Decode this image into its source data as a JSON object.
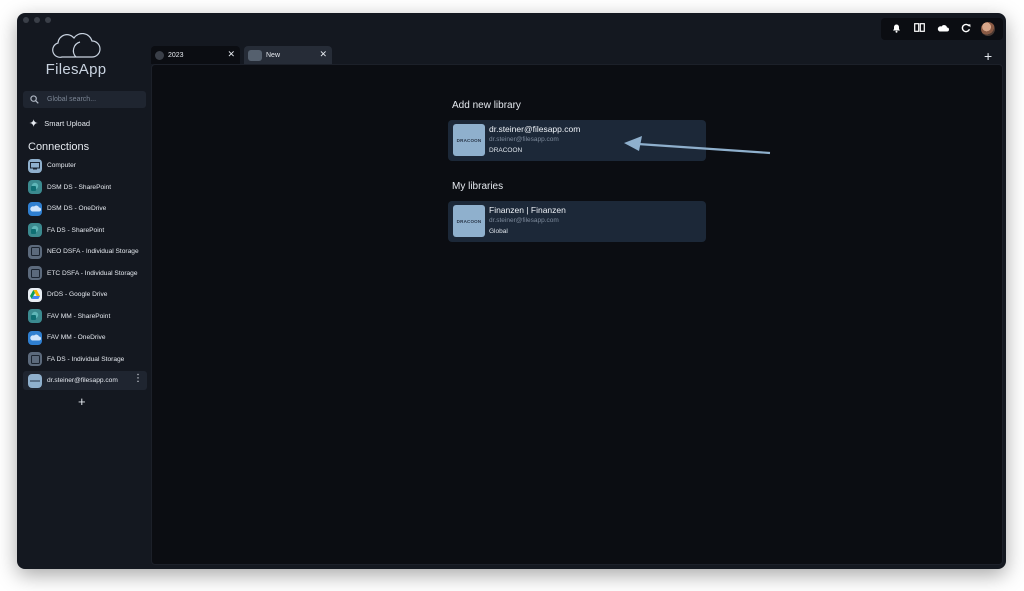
{
  "app": {
    "name": "FilesApp"
  },
  "sidebar": {
    "search_placeholder": "Global search...",
    "smart_upload": "Smart Upload",
    "connections_title": "Connections",
    "connections": [
      {
        "label": "Computer",
        "icon": "computer-icon",
        "color": "#8fb0cd"
      },
      {
        "label": "DSM DS - SharePoint",
        "icon": "sharepoint-icon",
        "color": "#3b8a8f"
      },
      {
        "label": "DSM DS - OneDrive",
        "icon": "onedrive-icon",
        "color": "#2f7fd0"
      },
      {
        "label": "FA DS - SharePoint",
        "icon": "sharepoint-icon",
        "color": "#3b8a8f"
      },
      {
        "label": "NEO DSFA - Individual Storage",
        "icon": "storage-icon",
        "color": "#5c6a7c"
      },
      {
        "label": "ETC DSFA - Individual Storage",
        "icon": "storage-icon",
        "color": "#5c6a7c"
      },
      {
        "label": "DrDS - Google Drive",
        "icon": "google-drive-icon",
        "color": "#e9eef4"
      },
      {
        "label": "FAV MM - SharePoint",
        "icon": "sharepoint-icon",
        "color": "#3b8a8f"
      },
      {
        "label": "FAV MM - OneDrive",
        "icon": "onedrive-icon",
        "color": "#2f7fd0"
      },
      {
        "label": "FA DS - Individual Storage",
        "icon": "storage-icon",
        "color": "#5c6a7c"
      },
      {
        "label": "dr.steiner@filesapp.com",
        "icon": "dracoon-icon",
        "color": "#8fb0cd"
      }
    ]
  },
  "tabs": [
    {
      "label": "2023"
    },
    {
      "label": "New"
    }
  ],
  "main": {
    "add_title": "Add new library",
    "add_card": {
      "thumb": "DRACOON",
      "title": "dr.steiner@filesapp.com",
      "subtitle": "dr.steiner@filesapp.com",
      "meta": "DRACOON"
    },
    "my_title": "My libraries",
    "my_card": {
      "thumb": "DRACOON",
      "title": "Finanzen | Finanzen",
      "subtitle": "dr.steiner@filesapp.com",
      "meta": "Global"
    }
  },
  "colors": {
    "accent_arrow": "#8fb0cd",
    "background": "#141820"
  }
}
